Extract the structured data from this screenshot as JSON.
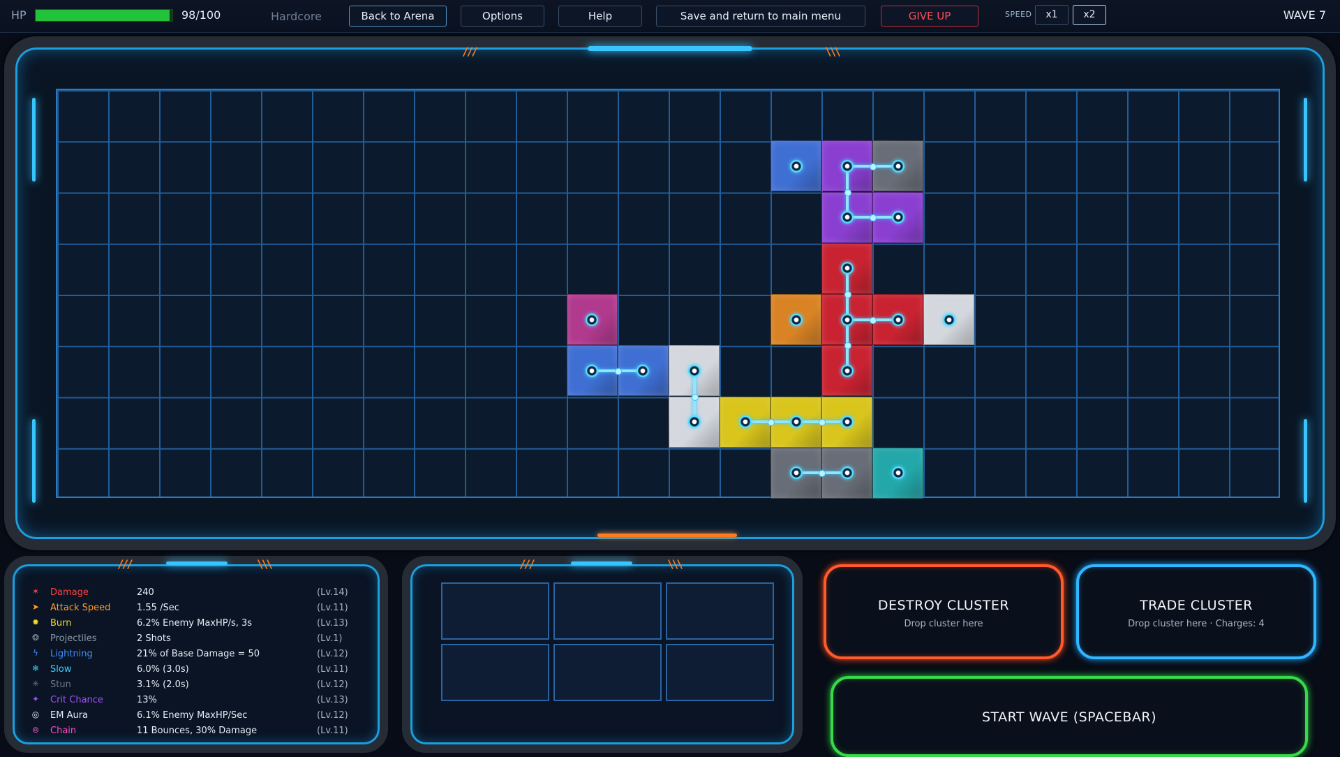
{
  "hud": {
    "hp_label": "HP",
    "hp_value": "98/100",
    "hp_fraction": 0.98,
    "mode": "Hardcore",
    "buttons": {
      "back": "Back to Arena",
      "options": "Options",
      "help": "Help",
      "save": "Save and return to main menu",
      "give_up": "GIVE UP"
    },
    "speed_label": "SPEED",
    "speed_options": [
      "x1",
      "x2"
    ],
    "speed_selected": "x2",
    "wave": "WAVE 7"
  },
  "colors": {
    "blue": "#3f6fd3",
    "purple": "#8a3fd1",
    "gray": "#686d77",
    "red": "#c92231",
    "orange": "#d98324",
    "white": "#d4d8de",
    "magenta": "#b13a8e",
    "yellow": "#d9c51c",
    "teal": "#23a7a9",
    "hp_green": "#23c23b",
    "accent_blue": "#1b9fe0",
    "danger_red": "#ff4b55"
  },
  "stats": [
    {
      "icon": "damage-icon",
      "glyph": "✶",
      "name": "Damage",
      "color": "#ff4040",
      "value": "240",
      "level": "(Lv.14)"
    },
    {
      "icon": "attack-speed-icon",
      "glyph": "➤",
      "name": "Attack Speed",
      "color": "#ff9a2e",
      "value": "1.55 /Sec",
      "level": "(Lv.11)"
    },
    {
      "icon": "burn-icon",
      "glyph": "✹",
      "name": "Burn",
      "color": "#f4d92a",
      "value": "6.2% Enemy MaxHP/s, 3s",
      "level": "(Lv.13)"
    },
    {
      "icon": "projectiles-icon",
      "glyph": "❂",
      "name": "Projectiles",
      "color": "#8d9aa8",
      "value": "2 Shots",
      "level": "(Lv.1)"
    },
    {
      "icon": "lightning-icon",
      "glyph": "ϟ",
      "name": "Lightning",
      "color": "#3f8dff",
      "value": "21% of Base Damage = 50",
      "level": "(Lv.12)"
    },
    {
      "icon": "slow-icon",
      "glyph": "❄",
      "name": "Slow",
      "color": "#39d3ff",
      "value": "6.0% (3.0s)",
      "level": "(Lv.11)"
    },
    {
      "icon": "stun-icon",
      "glyph": "✳",
      "name": "Stun",
      "color": "#6b7a89",
      "value": "3.1% (2.0s)",
      "level": "(Lv.12)"
    },
    {
      "icon": "crit-chance-icon",
      "glyph": "✦",
      "name": "Crit Chance",
      "color": "#a450ff",
      "value": "13%",
      "level": "(Lv.13)"
    },
    {
      "icon": "em-aura-icon",
      "glyph": "◎",
      "name": "EM Aura",
      "color": "#e6ebf2",
      "value": "6.1% Enemy MaxHP/Sec",
      "level": "(Lv.12)"
    },
    {
      "icon": "chain-icon",
      "glyph": "⊚",
      "name": "Chain",
      "color": "#ff4fc8",
      "value": "11 Bounces, 30% Damage",
      "level": "(Lv.11)"
    }
  ],
  "actions": {
    "destroy_title": "DESTROY CLUSTER",
    "destroy_sub": "Drop cluster here",
    "trade_title": "TRADE CLUSTER",
    "trade_sub": "Drop cluster here  ·  Charges: 4",
    "start_wave": "START WAVE   (SPACEBAR)"
  },
  "board": {
    "cols": 24,
    "rows": 8,
    "tiles": [
      {
        "c": 14,
        "r": 1,
        "color": "blue",
        "node": true
      },
      {
        "c": 15,
        "r": 1,
        "color": "purple",
        "node": true
      },
      {
        "c": 16,
        "r": 1,
        "color": "gray",
        "node": true
      },
      {
        "c": 15,
        "r": 2,
        "color": "purple",
        "node": true
      },
      {
        "c": 16,
        "r": 2,
        "color": "purple",
        "node": true
      },
      {
        "c": 15,
        "r": 3,
        "color": "red",
        "node": true
      },
      {
        "c": 14,
        "r": 4,
        "color": "orange",
        "node": true
      },
      {
        "c": 15,
        "r": 4,
        "color": "red",
        "node": true
      },
      {
        "c": 16,
        "r": 4,
        "color": "red",
        "node": true
      },
      {
        "c": 17,
        "r": 4,
        "color": "white",
        "node": true
      },
      {
        "c": 15,
        "r": 5,
        "color": "red",
        "node": true
      },
      {
        "c": 10,
        "r": 4,
        "color": "magenta",
        "node": true
      },
      {
        "c": 10,
        "r": 5,
        "color": "blue",
        "node": true
      },
      {
        "c": 11,
        "r": 5,
        "color": "blue",
        "node": true
      },
      {
        "c": 12,
        "r": 5,
        "color": "white",
        "node": true
      },
      {
        "c": 12,
        "r": 6,
        "color": "white",
        "node": true
      },
      {
        "c": 13,
        "r": 6,
        "color": "yellow",
        "node": true
      },
      {
        "c": 14,
        "r": 6,
        "color": "yellow",
        "node": true
      },
      {
        "c": 15,
        "r": 6,
        "color": "yellow",
        "node": true
      },
      {
        "c": 14,
        "r": 7,
        "color": "gray",
        "node": true
      },
      {
        "c": 15,
        "r": 7,
        "color": "gray",
        "node": true
      },
      {
        "c": 16,
        "r": 7,
        "color": "teal",
        "node": true
      }
    ],
    "links": [
      [
        15,
        1,
        16,
        1
      ],
      [
        15,
        1,
        15,
        2
      ],
      [
        15,
        2,
        16,
        2
      ],
      [
        15,
        3,
        15,
        4
      ],
      [
        15,
        4,
        16,
        4
      ],
      [
        15,
        4,
        15,
        5
      ],
      [
        10,
        5,
        11,
        5
      ],
      [
        12,
        5,
        12,
        6
      ],
      [
        13,
        6,
        14,
        6
      ],
      [
        14,
        6,
        15,
        6
      ],
      [
        14,
        7,
        15,
        7
      ]
    ]
  },
  "inventory_slots": 6
}
